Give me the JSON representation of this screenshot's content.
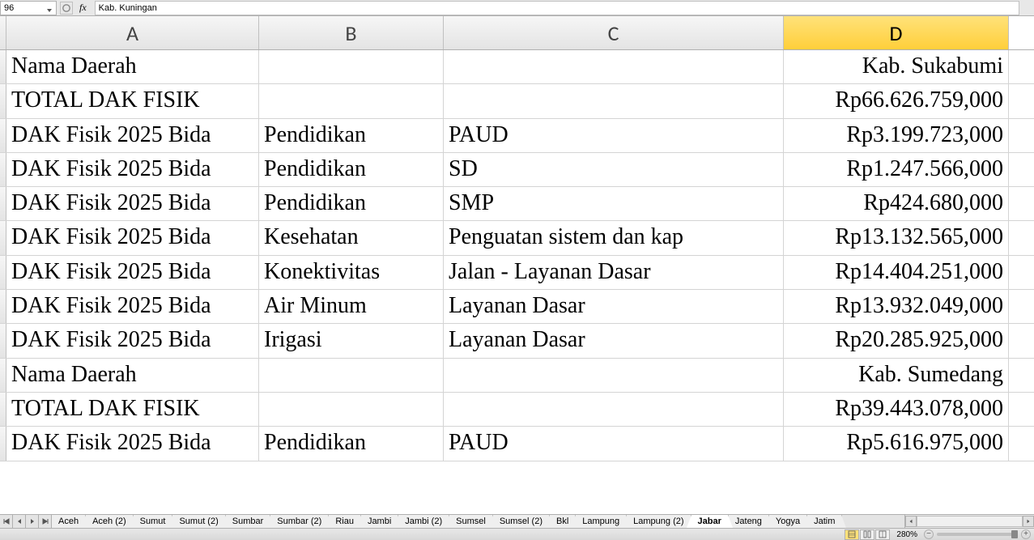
{
  "formula_bar": {
    "name_box": "96",
    "fx_label": "fx",
    "formula": "Kab. Kuningan"
  },
  "columns": [
    "A",
    "B",
    "C",
    "D"
  ],
  "active_column": "D",
  "rows": [
    {
      "A": "Nama Daerah",
      "B": "",
      "C": "",
      "D": "Kab. Sukabumi"
    },
    {
      "A": "TOTAL DAK FISIK",
      "B": "",
      "C": "",
      "D": "Rp66.626.759,000"
    },
    {
      "A": "DAK Fisik 2025 Bida",
      "B": "Pendidikan",
      "C": "PAUD",
      "D": "Rp3.199.723,000"
    },
    {
      "A": "DAK Fisik 2025 Bida",
      "B": "Pendidikan",
      "C": "SD",
      "D": "Rp1.247.566,000"
    },
    {
      "A": "DAK Fisik 2025 Bida",
      "B": "Pendidikan",
      "C": "SMP",
      "D": "Rp424.680,000"
    },
    {
      "A": "DAK Fisik 2025 Bida",
      "B": "Kesehatan",
      "C": "Penguatan sistem dan kap",
      "D": "Rp13.132.565,000"
    },
    {
      "A": "DAK Fisik 2025 Bida",
      "B": "Konektivitas",
      "C": "Jalan - Layanan Dasar",
      "D": "Rp14.404.251,000"
    },
    {
      "A": "DAK Fisik 2025 Bida",
      "B": "Air Minum",
      "C": "Layanan Dasar",
      "D": "Rp13.932.049,000"
    },
    {
      "A": "DAK Fisik 2025 Bida",
      "B": "Irigasi",
      "C": "Layanan Dasar",
      "D": "Rp20.285.925,000"
    },
    {
      "A": "Nama Daerah",
      "B": "",
      "C": "",
      "D": "Kab. Sumedang"
    },
    {
      "A": "TOTAL DAK FISIK",
      "B": "",
      "C": "",
      "D": "Rp39.443.078,000"
    },
    {
      "A": "DAK Fisik 2025 Bida",
      "B": "Pendidikan",
      "C": "PAUD",
      "D": "Rp5.616.975,000"
    }
  ],
  "sheet_tabs": [
    "Aceh",
    "Aceh (2)",
    "Sumut",
    "Sumut (2)",
    "Sumbar",
    "Sumbar (2)",
    "Riau",
    "Jambi",
    "Jambi (2)",
    "Sumsel",
    "Sumsel (2)",
    "Bkl",
    "Lampung",
    "Lampung (2)",
    "Jabar",
    "Jateng",
    "Yogya",
    "Jatim"
  ],
  "active_sheet": "Jabar",
  "status": {
    "zoom": "280%",
    "zoom_minus": "−",
    "zoom_plus": "+"
  }
}
